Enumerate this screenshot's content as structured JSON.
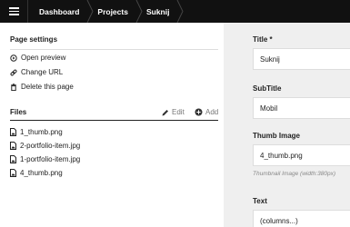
{
  "breadcrumb": {
    "items": [
      "Dashboard",
      "Projects",
      "Suknij"
    ]
  },
  "page_settings": {
    "title": "Page settings",
    "actions": [
      "Open preview",
      "Change URL",
      "Delete this page"
    ]
  },
  "files": {
    "title": "Files",
    "edit_label": "Edit",
    "add_label": "Add",
    "items": [
      "1_thumb.png",
      "2-portfolio-item.jpg",
      "1-portfolio-item.jpg",
      "4_thumb.png"
    ]
  },
  "form": {
    "title_label": "Title *",
    "title_value": "Suknij",
    "subtitle_label": "SubTitle",
    "subtitle_value": "Mobil",
    "thumb_label": "Thumb Image",
    "thumb_value": "4_thumb.png",
    "thumb_help": "Thumbnail Image (width:380px)",
    "text_label": "Text",
    "text_value": "(columns...)"
  },
  "icons": {
    "menu": "hamburger-menu-icon",
    "preview": "preview-icon",
    "url": "link-icon",
    "delete": "trash-icon",
    "edit": "pencil-icon",
    "add": "plus-circle-icon",
    "file": "file-image-icon"
  },
  "colors": {
    "topbar": "#111111",
    "form_bg": "#efefef"
  }
}
